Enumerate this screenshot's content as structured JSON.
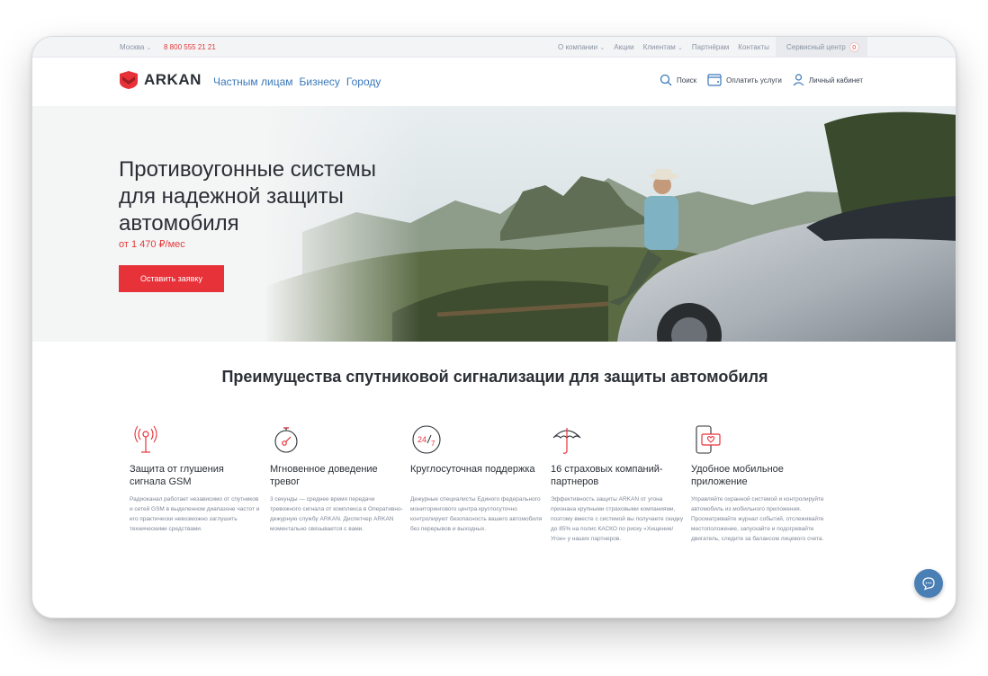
{
  "topbar": {
    "city": "Москва",
    "phone": "8 800 555 21 21",
    "links": [
      "О компании",
      "Акции",
      "Клиентам",
      "Партнёрам",
      "Контакты"
    ],
    "service_center": "Сервисный центр",
    "service_count": "0"
  },
  "header": {
    "logo": "ARKAN",
    "nav": [
      "Частным лицам",
      "Бизнесу",
      "Городу"
    ],
    "search": "Поиск",
    "pay": "Оплатить услуги",
    "account": "Личный кабинет"
  },
  "hero": {
    "title": "Противоугонные системы для надежной защиты автомобиля",
    "price": "от 1 470 ₽/мес",
    "button": "Оставить заявку"
  },
  "section_title": "Преимущества спутниковой сигнализации для защиты автомобиля",
  "features": [
    {
      "icon": "antenna-icon",
      "title": "Защита от глушения сигнала GSM",
      "text": "Радиоканал работает независимо от спутников и сетей GSM в выделенном диапазоне частот и его практически невозможно заглушить техническими средствами."
    },
    {
      "icon": "stopwatch-icon",
      "title": "Мгновенное доведение тревог",
      "text": "3 секунды — среднее время передачи тревожного сигнала от комплекса в Оперативно-дежурную службу ARKAN. Диспетчер ARKAN моментально связывается с вами."
    },
    {
      "icon": "24-7-icon",
      "title": "Круглосуточная поддержка",
      "text": "Дежурные специалисты Единого федерального мониторингового центра круглосуточно контролируют безопасность вашего автомобиля без перерывов и выходных."
    },
    {
      "icon": "umbrella-icon",
      "title": "16 страховых компаний-партнеров",
      "text": "Эффективность защиты ARKAN от угона признана крупными страховыми компаниями, поэтому вместе с системой вы получаете скидку до 85% на полис КАСКО по риску «Хищение/Угон» у наших партнеров."
    },
    {
      "icon": "mobile-app-icon",
      "title": "Удобное мобильное приложение",
      "text": "Управляйте охранной системой и контролируйте автомобиль из мобильного приложения. Просматривайте журнал событий, отслеживайте местоположение, запускайте и подогревайте двигатель, следите за балансом лицевого счета."
    }
  ],
  "colors": {
    "accent": "#e8323a",
    "link": "#3a78b9",
    "chat": "#4a7fb5"
  }
}
